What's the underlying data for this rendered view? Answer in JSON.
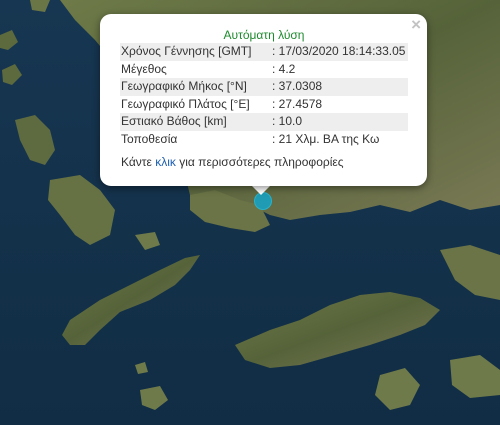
{
  "popup": {
    "title": "Αυτόματη λύση",
    "close_symbol": "×",
    "rows": [
      {
        "label": "Χρόνος Γέννησης [GMT]",
        "value": ": 17/03/2020 18:14:33.05"
      },
      {
        "label": "Μέγεθος",
        "value": ": 4.2"
      },
      {
        "label": "Γεωγραφικό Μήκος [°N]",
        "value": ": 37.0308"
      },
      {
        "label": "Γεωγραφικό Πλάτος [°E]",
        "value": ": 27.4578"
      },
      {
        "label": "Εστιακό Βάθος [km]",
        "value": ": 10.0"
      },
      {
        "label": "Τοποθεσία",
        "value": ": 21 Χλμ. ΒΑ της Κω"
      }
    ],
    "more_prefix": "Κάντε ",
    "more_link": "κλικ",
    "more_suffix": " για περισσότερες πληροφορίες"
  },
  "marker": {
    "icon": "earthquake-marker-icon",
    "color": "#1f9bb4"
  },
  "map": {
    "sea_color": "#14324b",
    "land_color": "#5c6a3d",
    "style": "satellite"
  }
}
